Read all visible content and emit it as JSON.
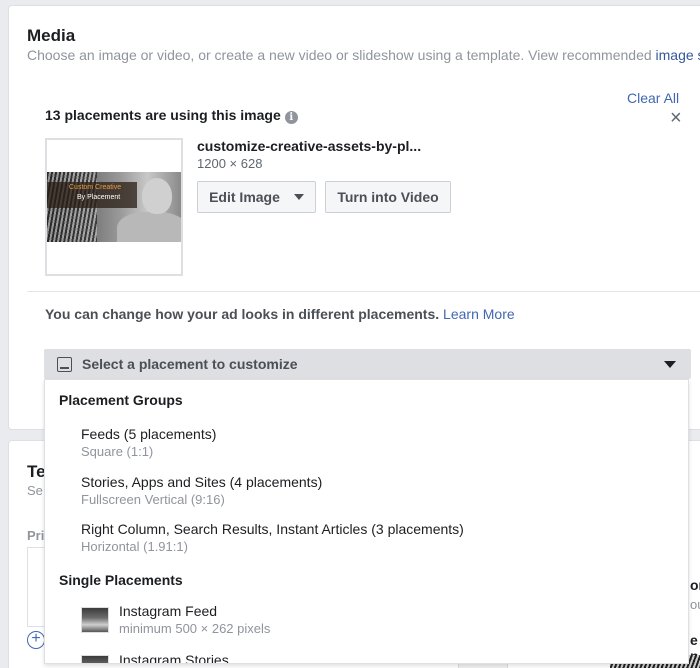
{
  "media": {
    "title": "Media",
    "subtitle": "Choose an image or video, or create a new video or slideshow using a template. View recommended ",
    "subtitle_link": "image spe",
    "clear_all": "Clear All",
    "close_icon": "×",
    "using_label": "13 placements are using this image",
    "info_icon": "i",
    "thumbnail": {
      "line1": "Custom Creative",
      "line2": "By Placement"
    },
    "file_name": "customize-creative-assets-by-pl...",
    "file_dims": "1200 × 628",
    "edit_image": "Edit Image",
    "turn_into_video": "Turn into Video",
    "change_text": "You can change how your ad looks in different placements.",
    "learn_more": "Learn More",
    "select_placeholder": "Select a placement to customize"
  },
  "dropdown": {
    "groups_header": "Placement Groups",
    "groups": [
      {
        "title": "Feeds (5 placements)",
        "sub": "Square (1:1)"
      },
      {
        "title": "Stories, Apps and Sites (4 placements)",
        "sub": "Fullscreen Vertical (9:16)"
      },
      {
        "title": "Right Column, Search Results, Instant Articles (3 placements)",
        "sub": "Horizontal (1.91:1)"
      }
    ],
    "singles_header": "Single Placements",
    "singles": [
      {
        "title": "Instagram Feed",
        "sub": "minimum 500 × 262 pixels"
      },
      {
        "title": "Instagram Stories",
        "sub": ""
      }
    ]
  },
  "text_card": {
    "title": "Te",
    "subtitle": "Se",
    "primary_label": "Pri",
    "add_icon": "+"
  },
  "peek": {
    "line1": "on",
    "line2": "ou",
    "line3": "e p"
  },
  "colors": {
    "link": "#4267b2",
    "background": "#e9ebee",
    "select_bar": "#dddfe2"
  }
}
